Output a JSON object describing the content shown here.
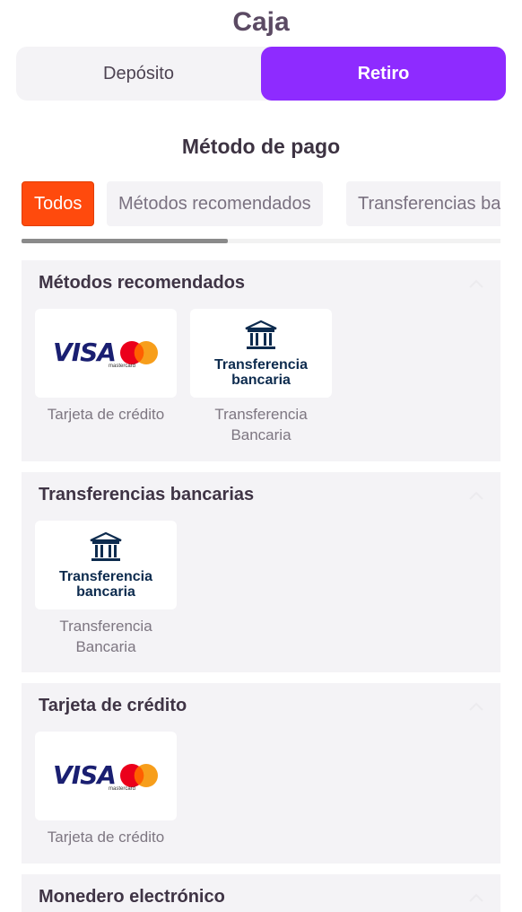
{
  "header": {
    "title": "Caja"
  },
  "segments": [
    {
      "label": "Depósito",
      "active": false
    },
    {
      "label": "Retiro",
      "active": true
    }
  ],
  "payment_method_heading": "Método de pago",
  "filters": [
    {
      "label": "Todos",
      "active": true
    },
    {
      "label": "Métodos recomendados",
      "active": false
    },
    {
      "label": "Transferencias ba",
      "active": false
    }
  ],
  "sections": [
    {
      "title": "Métodos recomendados",
      "tiles": [
        {
          "logo": "visa-mastercard",
          "label": "Tarjeta de crédito"
        },
        {
          "logo": "bank-transfer",
          "label": "Transferencia Bancaria"
        }
      ]
    },
    {
      "title": "Transferencias bancarias",
      "tiles": [
        {
          "logo": "bank-transfer",
          "label": "Transferencia Bancaria"
        }
      ]
    },
    {
      "title": "Tarjeta de crédito",
      "tiles": [
        {
          "logo": "visa-mastercard",
          "label": "Tarjeta de crédito"
        }
      ]
    },
    {
      "title": "Monedero electrónico",
      "tiles": []
    }
  ],
  "logos": {
    "visa_text": "VISA",
    "mastercard_text": "mastercard",
    "bank_line1": "Transferencia",
    "bank_line2": "bancaria"
  },
  "colors": {
    "accent_purple": "#8e2bff",
    "filter_active": "#ff4a0d",
    "panel_bg": "#f4f3f6"
  }
}
